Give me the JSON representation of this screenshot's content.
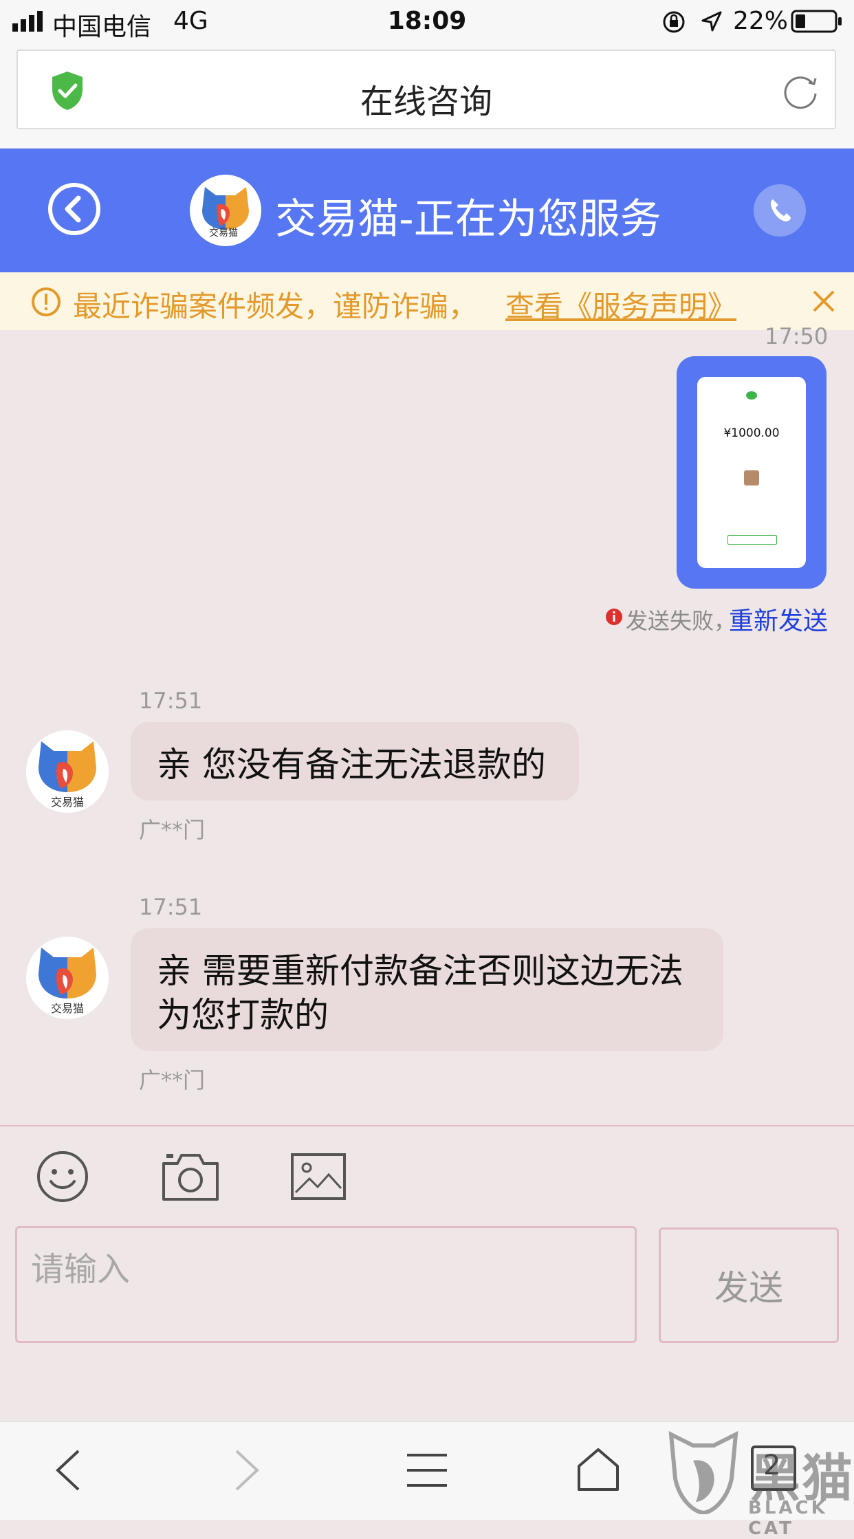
{
  "status_bar": {
    "carrier": "中国电信",
    "network": "4G",
    "time": "18:09",
    "battery": "22%"
  },
  "browser": {
    "title": "在线咨询"
  },
  "chat_header": {
    "title": "交易猫-正在为您服务",
    "logo_text": "交易猫"
  },
  "warning": {
    "text": "最近诈骗案件频发，谨防诈骗，",
    "link": "查看《服务声明》"
  },
  "messages": [
    {
      "time": "17:50",
      "type": "image",
      "image_amount": "¥1000.00",
      "status_text": "发送失败，",
      "retry_label": "重新发送"
    },
    {
      "time": "17:51",
      "text": "亲 您没有备注无法退款的",
      "sender": "广**门"
    },
    {
      "time": "17:51",
      "text_line1": "亲 需要重新付款备注否则这边无法",
      "text_line2": "为您打款的",
      "sender": "广**门"
    }
  ],
  "composer": {
    "placeholder": "请输入",
    "send_label": "发送"
  },
  "bottom_nav": {
    "tab_count": "2",
    "watermark": "黑猫",
    "watermark_sub": "BLACK CAT"
  },
  "colors": {
    "header_blue": "#5677f1",
    "warning_orange": "#e39a2c",
    "link_blue": "#1f3fdc",
    "bubble": "#e9dadb"
  }
}
